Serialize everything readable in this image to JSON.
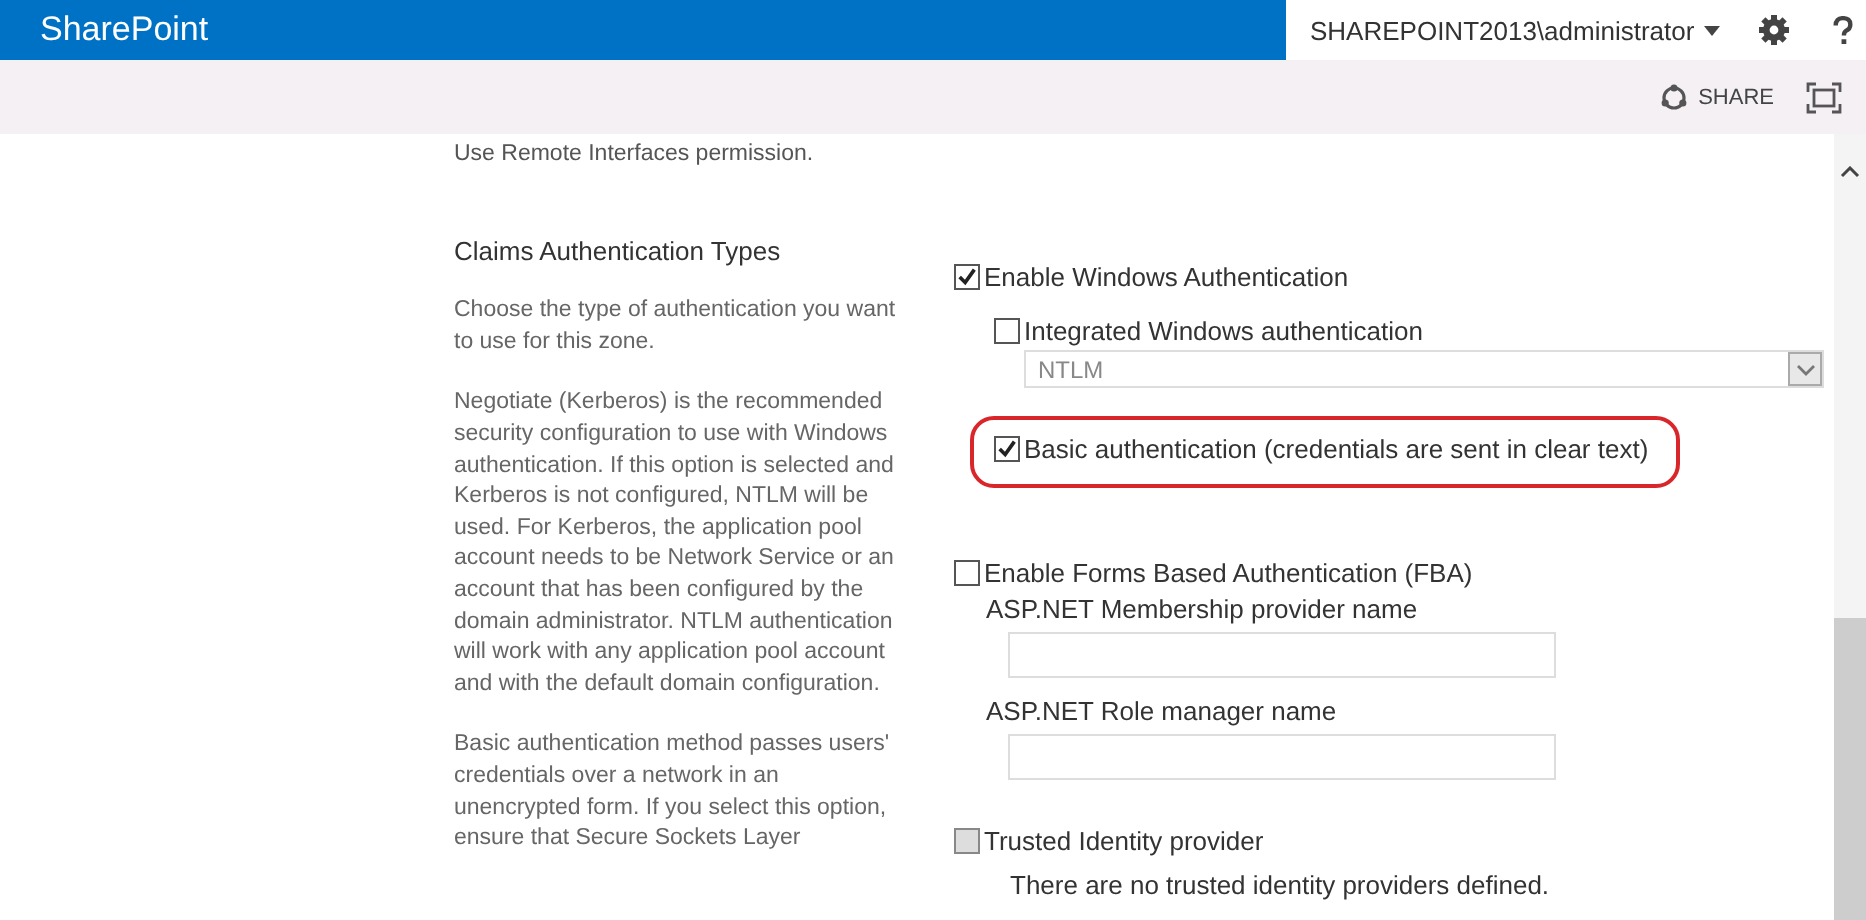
{
  "top_bar": {
    "brand": "SharePoint",
    "user": "SHAREPOINT2013\\administrator"
  },
  "ribbon": {
    "share_label": "SHARE"
  },
  "intro_text": "Use Remote Interfaces permission.",
  "section": {
    "title": "Claims Authentication Types",
    "paragraphs": [
      "Choose the type of authentication you want to use for this zone.",
      "Negotiate (Kerberos) is the recommended security configuration to use with Windows authentication. If this option is selected and Kerberos is not configured, NTLM will be used. For Kerberos, the application pool account needs to be Network Service or an account that has been configured by the domain administrator. NTLM authentication will work with any application pool account and with the default domain configuration.",
      "Basic authentication method passes users' credentials over a network in an unencrypted form. If you select this option, ensure that Secure Sockets Layer"
    ]
  },
  "windows_auth": {
    "label": "Enable Windows Authentication",
    "checked": true,
    "integrated": {
      "label": "Integrated Windows authentication",
      "checked": false
    },
    "method_select": {
      "value": "NTLM",
      "disabled": true
    },
    "basic": {
      "label": "Basic authentication (credentials are sent in clear text)",
      "checked": true,
      "highlighted": true
    }
  },
  "forms_auth": {
    "label": "Enable Forms Based Authentication (FBA)",
    "checked": false,
    "fields": [
      {
        "label": "ASP.NET Membership provider name"
      },
      {
        "label": "ASP.NET Role manager name"
      }
    ]
  },
  "trusted": {
    "label": "Trusted Identity provider",
    "checked": false,
    "disabled": true,
    "note": "There are no trusted identity providers defined."
  }
}
